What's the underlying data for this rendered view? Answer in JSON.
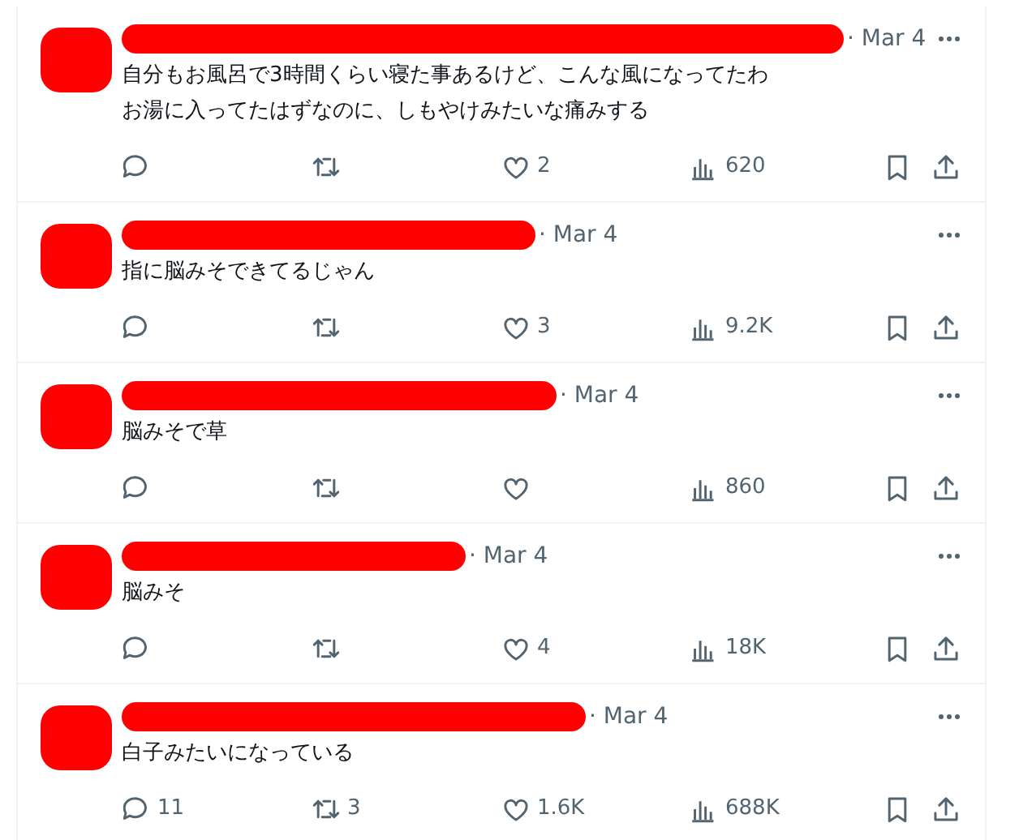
{
  "posts": [
    {
      "separator": "·",
      "date": "Mar 4",
      "text": "自分もお風呂で3時間くらい寝た事あるけど、こんな風になってたわ",
      "text_2": "お湯に入ってたはずなのに、しもやけみたいな痛みする",
      "likes": "2",
      "views": "620"
    },
    {
      "separator": "·",
      "date": "Mar 4",
      "text": "指に脳みそできてるじゃん",
      "likes": "3",
      "views": "9.2K"
    },
    {
      "separator": "·",
      "date": "Mar 4",
      "text": "脳みそで草",
      "views": "860"
    },
    {
      "separator": "·",
      "date": "Mar 4",
      "text": "脳みそ",
      "likes": "4",
      "views": "18K"
    },
    {
      "separator": "·",
      "date": "Mar 4",
      "text": "白子みたいになっている",
      "replies": "11",
      "reposts": "3",
      "likes": "1.6K",
      "views": "688K"
    }
  ]
}
